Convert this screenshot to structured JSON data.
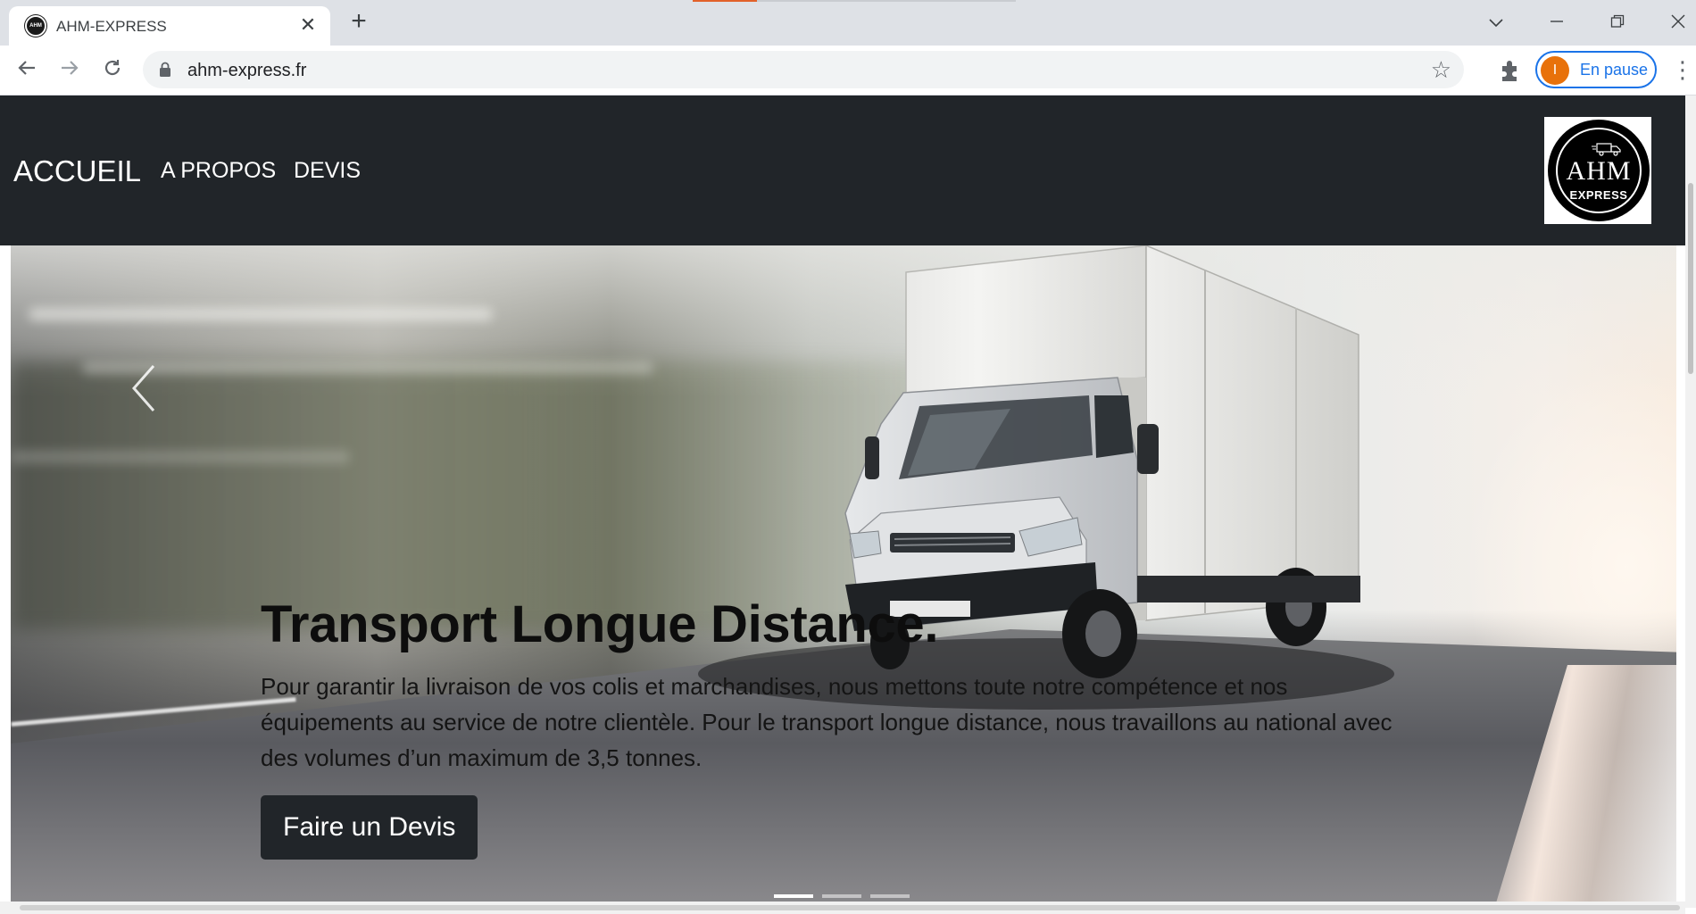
{
  "browser": {
    "tab": {
      "title": "AHM-EXPRESS",
      "favicon_text": "AHM"
    },
    "new_tab_icon": "plus-icon",
    "url": "ahm-express.fr",
    "profile_initial": "I",
    "profile_status": "En pause",
    "colors": {
      "tabstrip": "#dee1e6",
      "profile_accent": "#1a73e8",
      "avatar": "#e8710a"
    }
  },
  "site": {
    "nav": {
      "brand": "ACCUEIL",
      "links": [
        "A PROPOS",
        "DEVIS"
      ]
    },
    "logo": {
      "main": "AHM",
      "sub": "EXPRESS"
    },
    "carousel": {
      "slide": {
        "title": "Transport Longue Distance.",
        "text": "Pour garantir la livraison de vos colis et marchandises, nous mettons toute notre compétence et nos équipements au service de notre clientèle. Pour le transport longue distance, nous travaillons au national avec des volumes d’un maximum de 3,5 tonnes.",
        "button": "Faire un Devis"
      },
      "indicator_count": 3,
      "active_index": 0
    },
    "colors": {
      "navbar": "#212529",
      "button": "#212529"
    }
  }
}
